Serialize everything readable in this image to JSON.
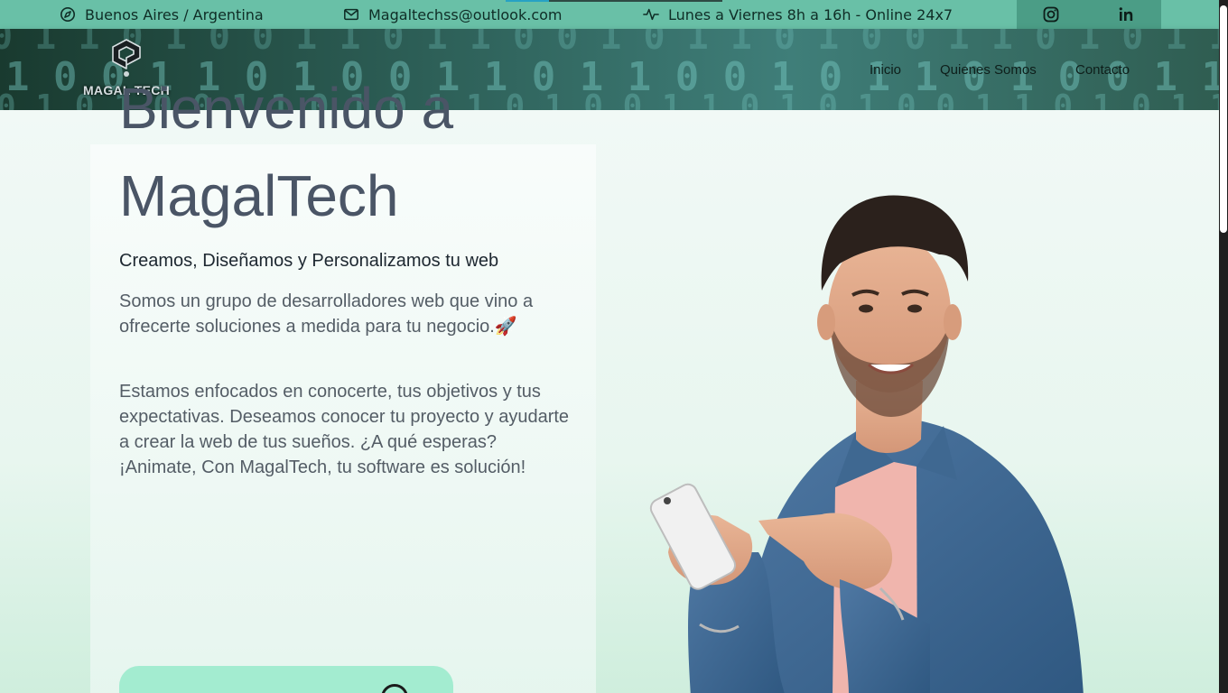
{
  "topbar": {
    "location": "Buenos Aires / Argentina",
    "email": "Magaltechss@outlook.com",
    "hours": "Lunes a Viernes 8h a 16h - Online 24x7",
    "load_progress": 0.2
  },
  "social": {
    "instagram_icon": "instagram-icon",
    "linkedin_icon": "linkedin-icon"
  },
  "logo": {
    "text": "MAGAL TECH"
  },
  "nav": {
    "inicio": "Inicio",
    "quienes": "Quienes Somos",
    "contacto": "Contacto"
  },
  "hero": {
    "title_line1": "Bienvenido a",
    "title_line2": "MagalTech",
    "subtitle": "Creamos, Diseñamos y Personalizamos tu web",
    "paragraph1": "Somos un grupo de desarrolladores web que vino a ofrecerte soluciones a medida para tu negocio.🚀",
    "paragraph2": "Estamos enfocados en conocerte, tus objetivos y tus expectativas. Deseamos conocer tu proyecto y ayudarte a crear la web de tus sueños. ¿A qué esperas? ¡Animate, Con MagalTech, tu software es solución!"
  },
  "colors": {
    "topbar": "#69c0a7",
    "social_bg": "#4b9d86",
    "title": "#4a5566",
    "cta": "#a3ecd0"
  }
}
